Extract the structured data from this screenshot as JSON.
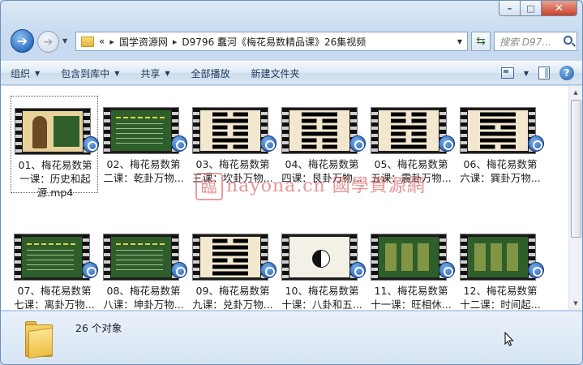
{
  "window": {
    "caption_buttons": {
      "minimize": "–",
      "maximize": "□",
      "close": "✕"
    }
  },
  "nav": {
    "back_icon": "back-arrow-icon",
    "forward_icon": "forward-arrow-icon",
    "address": {
      "chevron": "«",
      "segments": [
        "国学资源网",
        "D9796 蠢河《梅花易数精品课》26集视频"
      ],
      "separator": "▸"
    },
    "search": {
      "placeholder": "搜索 D97..."
    }
  },
  "toolbar": {
    "organize": "组织",
    "include_in_library": "包含到库中",
    "share": "共享",
    "play_all": "全部播放",
    "new_folder": "新建文件夹"
  },
  "files": [
    {
      "line1": "01、梅花易数第",
      "line2": "一课：历史和起",
      "line3": "源.mp4",
      "thumb": "portrait",
      "selected": true
    },
    {
      "line1": "02、梅花易数第",
      "line2": "二课：乾卦万物...",
      "thumb": "green",
      "selected": false
    },
    {
      "line1": "03、梅花易数第",
      "line2": "三课：坎卦万物...",
      "thumb": "hexagram-kan",
      "selected": false
    },
    {
      "line1": "04、梅花易数第",
      "line2": "四课：艮卦万物...",
      "thumb": "hexagram-gen",
      "selected": false
    },
    {
      "line1": "05、梅花易数第",
      "line2": "五课：震卦万物...",
      "thumb": "hexagram-zhen",
      "selected": false
    },
    {
      "line1": "06、梅花易数第",
      "line2": "六课：巽卦万物...",
      "thumb": "hexagram-xun",
      "selected": false
    },
    {
      "line1": "07、梅花易数第",
      "line2": "七课：离卦万物...",
      "thumb": "green",
      "selected": false
    },
    {
      "line1": "08、梅花易数第",
      "line2": "八课：坤卦万物...",
      "thumb": "green",
      "selected": false
    },
    {
      "line1": "09、梅花易数第",
      "line2": "九课：兑卦万物...",
      "thumb": "hexagram-dui",
      "selected": false
    },
    {
      "line1": "10、梅花易数第",
      "line2": "十课：八卦和五...",
      "thumb": "bagua",
      "selected": false
    },
    {
      "line1": "11、梅花易数第",
      "line2": "十一课：旺相休...",
      "thumb": "chartgreen",
      "selected": false
    },
    {
      "line1": "12、梅花易数第",
      "line2": "十二课：时间起...",
      "thumb": "chartgreen",
      "selected": false
    }
  ],
  "status": {
    "count_text": "26 个对象"
  },
  "watermark": {
    "seal": "臨",
    "text": "nayona.cn 國學資源網"
  }
}
